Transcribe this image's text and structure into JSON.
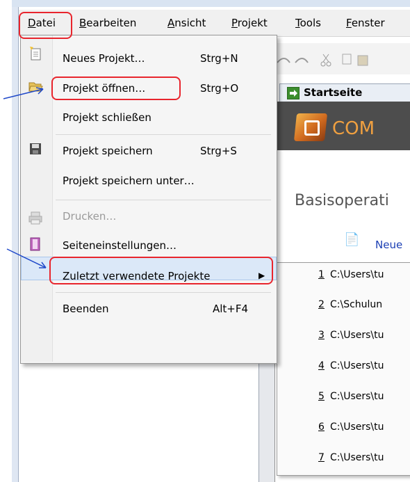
{
  "menubar": {
    "items": [
      "Datei",
      "Bearbeiten",
      "Ansicht",
      "Projekt",
      "Tools",
      "Fenster"
    ]
  },
  "file_menu": {
    "items": [
      {
        "label": "Neues Projekt…",
        "shortcut": "Strg+N",
        "icon": "new-project-icon"
      },
      {
        "label": "Projekt öffnen…",
        "shortcut": "Strg+O",
        "icon": "open-folder-icon"
      },
      {
        "label": "Projekt schließen",
        "shortcut": "",
        "icon": ""
      },
      {
        "label": "Projekt speichern",
        "shortcut": "Strg+S",
        "icon": "save-disk-icon"
      },
      {
        "label": "Projekt speichern unter…",
        "shortcut": "",
        "icon": ""
      },
      {
        "label": "Drucken…",
        "shortcut": "",
        "icon": "printer-icon",
        "disabled": true
      },
      {
        "label": "Seiteneinstellungen…",
        "shortcut": "",
        "icon": "page-setup-icon"
      },
      {
        "label": "Zuletzt verwendete Projekte",
        "shortcut": "",
        "icon": "",
        "submenu": true
      },
      {
        "label": "Beenden",
        "shortcut": "Alt+F4",
        "icon": ""
      }
    ]
  },
  "recent_projects": [
    {
      "num": "1",
      "path": "C:\\Users\\tu"
    },
    {
      "num": "2",
      "path": "C:\\Schulun"
    },
    {
      "num": "3",
      "path": "C:\\Users\\tu"
    },
    {
      "num": "4",
      "path": "C:\\Users\\tu"
    },
    {
      "num": "5",
      "path": "C:\\Users\\tu"
    },
    {
      "num": "6",
      "path": "C:\\Users\\tu"
    },
    {
      "num": "7",
      "path": "C:\\Users\\tu"
    }
  ],
  "start_page": {
    "tab_label": "Startseite",
    "banner_text": "COM",
    "heading": "Basisoperati",
    "link_new": "Neue"
  },
  "colors": {
    "highlight": "#dbe8f8",
    "annotation_red": "#e8252d",
    "link_blue": "#1b3fb4",
    "banner": "#4d4d4d"
  }
}
